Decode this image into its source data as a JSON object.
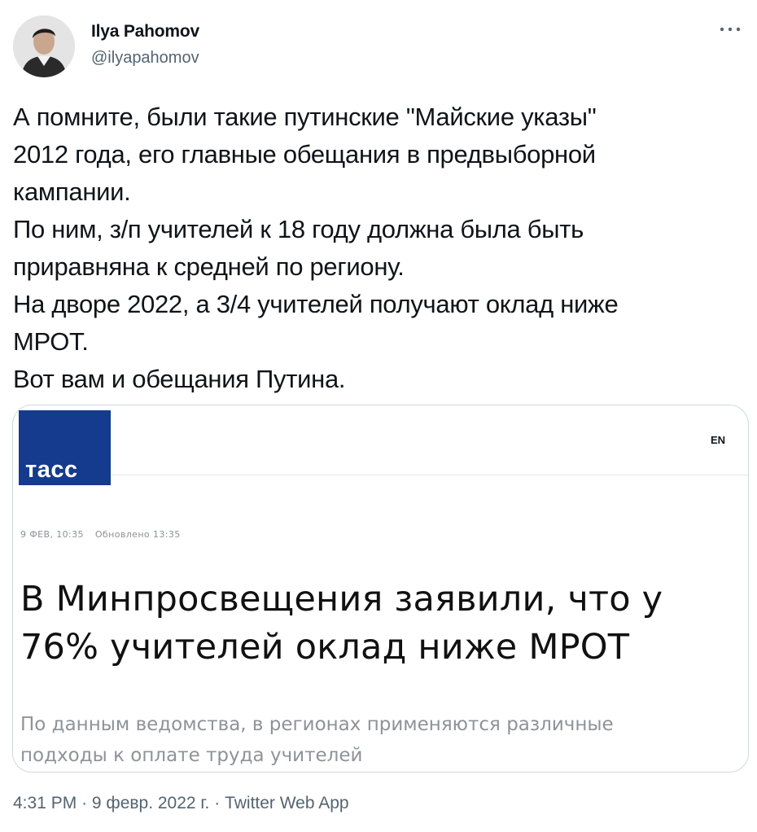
{
  "author": {
    "name": "Ilya Pahomov",
    "handle": "@ilyapahomov"
  },
  "tweet": {
    "lines": [
      "А помните, были такие  путинские \"Майские указы\"",
      "2012 года, его главные обещания в предвыборной",
      "кампании.",
      "По ним, з/п учителей к 18 году должна была быть",
      "приравняна к средней по региону.",
      "На дворе 2022, а 3/4 учителей получают оклад ниже",
      "МРОТ.",
      "Вот вам и обещания Путина."
    ]
  },
  "card": {
    "logo_text": "тасс",
    "lang": "EN",
    "date": "9 ФЕВ, 10:35",
    "updated": "Обновлено 13:35",
    "headline_lines": [
      "В Минпросвещения заявили, что у",
      "76% учителей оклад ниже МРОТ"
    ],
    "lead_lines": [
      "По данным ведомства, в регионах применяются различные",
      "подходы к оплате труда учителей"
    ]
  },
  "footer": {
    "time": "4:31 PM",
    "date": "9 февр. 2022 г.",
    "source": "Twitter Web App",
    "separator": "·"
  },
  "icons": {
    "more": "more-horizontal-icon"
  },
  "colors": {
    "text": "#0f1419",
    "secondary": "#536471",
    "tass_blue": "#153b8e",
    "card_border": "#cfd9de"
  }
}
